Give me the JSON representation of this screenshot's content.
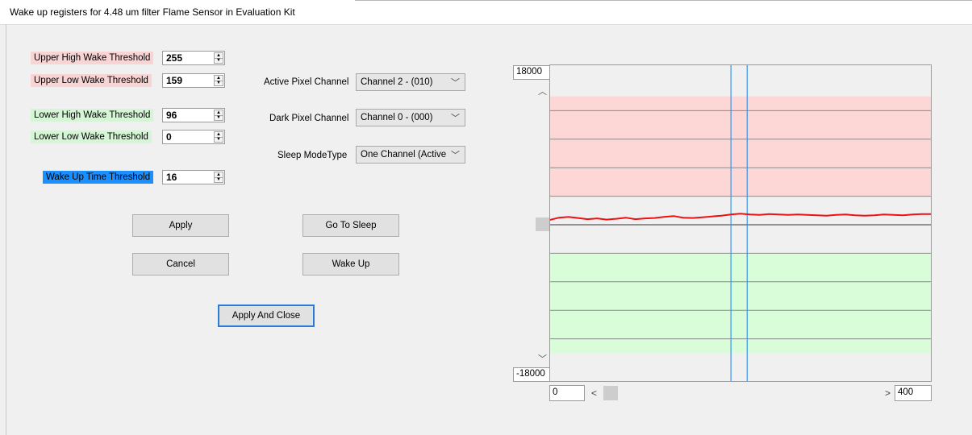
{
  "window": {
    "title": "Wake up registers for 4.48 um filter Flame Sensor in Evaluation Kit"
  },
  "thresholds": {
    "upper_high": {
      "label": "Upper High Wake Threshold",
      "value": "255"
    },
    "upper_low": {
      "label": "Upper Low Wake Threshold",
      "value": "159"
    },
    "lower_high": {
      "label": "Lower High Wake Threshold",
      "value": "96"
    },
    "lower_low": {
      "label": "Lower Low Wake Threshold",
      "value": "0"
    },
    "wake_time": {
      "label": "Wake Up Time Threshold",
      "value": "16"
    }
  },
  "channels": {
    "active": {
      "label": "Active Pixel Channel",
      "selected": "Channel 2 - (010)"
    },
    "dark": {
      "label": "Dark Pixel Channel",
      "selected": "Channel 0 - (000)"
    },
    "sleep_mode": {
      "label": "Sleep ModeType",
      "selected": "One Channel (Active"
    }
  },
  "buttons": {
    "apply": "Apply",
    "cancel": "Cancel",
    "go_to_sleep": "Go To Sleep",
    "wake_up": "Wake Up",
    "apply_close": "Apply And Close"
  },
  "icons": {
    "spin_up": "spin-up-arrow-icon",
    "spin_down": "spin-down-arrow-icon",
    "dropdown": "chevron-down-icon",
    "scroll_up": "chevron-up-icon",
    "scroll_down": "chevron-down-icon",
    "scroll_left": "chevron-left-icon",
    "scroll_right": "chevron-right-icon"
  },
  "colors": {
    "upper_band": "#fdd6d6",
    "lower_band": "#d8fdd8",
    "signal": "#ee1111",
    "cursor": "#3a8ee6",
    "wake_time_label": "#1a8fff"
  },
  "chart": {
    "y_max": "18000",
    "y_min": "-18000",
    "x_start": "0",
    "x_end": "400"
  },
  "chart_data": {
    "type": "line",
    "ylim": [
      -18000,
      18000
    ],
    "xlim": [
      0,
      400
    ],
    "grid": true,
    "bands": [
      {
        "name": "upper",
        "from": 3600,
        "to": 16200,
        "color": "#fdd6d6"
      },
      {
        "name": "lower",
        "from": -16200,
        "to": -3600,
        "color": "#d8fdd8"
      }
    ],
    "cursors": [
      190,
      207
    ],
    "series": [
      {
        "color": "#ee1111",
        "x": [
          0,
          10,
          20,
          30,
          40,
          50,
          60,
          70,
          80,
          90,
          100,
          110,
          120,
          130,
          140,
          150,
          160,
          170,
          180,
          190,
          200,
          210,
          220,
          230,
          240,
          250,
          260,
          270,
          280,
          290,
          300,
          310,
          320,
          330,
          340,
          350,
          360,
          370,
          380,
          390,
          400
        ],
        "y": [
          600,
          900,
          1000,
          850,
          700,
          800,
          650,
          750,
          900,
          700,
          800,
          850,
          1000,
          1100,
          900,
          850,
          950,
          1050,
          1150,
          1300,
          1400,
          1300,
          1250,
          1350,
          1300,
          1250,
          1300,
          1250,
          1200,
          1150,
          1250,
          1300,
          1200,
          1150,
          1200,
          1300,
          1250,
          1200,
          1300,
          1350,
          1350
        ]
      }
    ]
  }
}
